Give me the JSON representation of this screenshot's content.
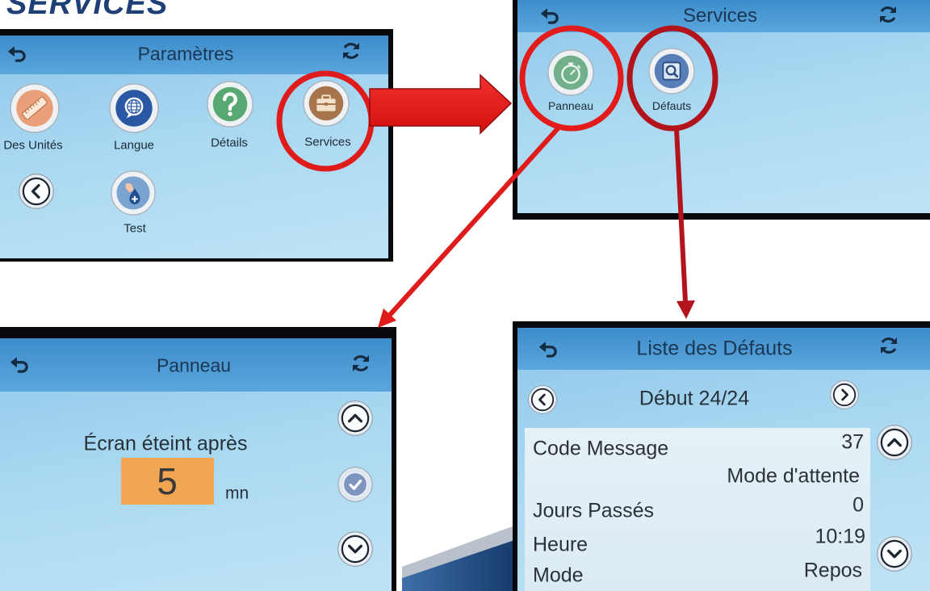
{
  "slide": {
    "title": "SERVICES"
  },
  "colors": {
    "annotation_red": "#e01b1b",
    "annotation_dark_red": "#b3131b",
    "value_box_orange": "#f2a654",
    "screen_blue": "#a9d8f1",
    "header_blue": "#4a98d3"
  },
  "screens": {
    "parametres": {
      "title": "Paramètres",
      "back_button_icon": "chevron-left-icon",
      "icons": [
        {
          "label": "Des Unités",
          "icon": "ruler-icon"
        },
        {
          "label": "Langue",
          "icon": "globe-speech-icon"
        },
        {
          "label": "Détails",
          "icon": "question-icon"
        },
        {
          "label": "Services",
          "icon": "briefcase-icon",
          "highlighted": true
        },
        {
          "label": "Test",
          "icon": "hand-drop-icon"
        }
      ]
    },
    "services": {
      "title": "Services",
      "icons": [
        {
          "label": "Panneau",
          "icon": "stopwatch-icon",
          "highlighted": true
        },
        {
          "label": "Défauts",
          "icon": "magnifier-icon",
          "highlighted": true
        }
      ]
    },
    "panneau": {
      "title": "Panneau",
      "setting_label": "Écran éteint après",
      "value": "5",
      "unit": "mn"
    },
    "defauts": {
      "title": "Liste des Défauts",
      "position": "Début 24/24",
      "rows": [
        {
          "label": "Code Message",
          "value": "37"
        },
        {
          "value": "Mode d'attente"
        },
        {
          "label": "Jours Passés",
          "value": "0"
        },
        {
          "label": "Heure",
          "value": "10:19"
        },
        {
          "label": "Mode",
          "value": "Repos"
        }
      ]
    }
  }
}
